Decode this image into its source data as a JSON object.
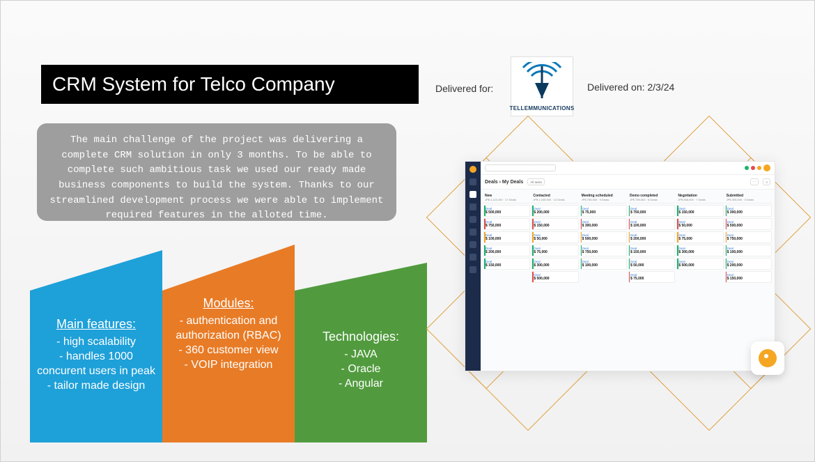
{
  "title": "CRM System for Telco Company",
  "description": "The main challenge of the project was delivering a complete CRM solution in only 3 months. To be able to complete such ambitious task we used our ready made business components to build the system. Thanks to our streamlined development process we were able to implement required features in the alloted time.",
  "delivered_for_label": "Delivered for:",
  "delivered_on_label": "Delivered on: 2/3/24",
  "logo_text": "TELLEMMUNICATIONS",
  "cards": {
    "features": {
      "heading": "Main features:",
      "l1": "- high scalability",
      "l2": "- handles 1000 concurent users in peak",
      "l3": "- tailor made design"
    },
    "modules": {
      "heading": "Modules:",
      "l1": "- authentication and authorization (RBAC)",
      "l2": "- 360 customer view",
      "l3": "- VOIP integration"
    },
    "tech": {
      "heading": "Technologies:",
      "l1": "- JAVA",
      "l2": "- Oracle",
      "l3": "- Angular"
    }
  },
  "app": {
    "breadcrumb": "Deals › My Deals",
    "columns": [
      {
        "title": "New",
        "sub": "JP$ 4,119,200 · 17 Deals"
      },
      {
        "title": "Contacted",
        "sub": "JP$ 1,045,000 · 12 Deals"
      },
      {
        "title": "Meeting scheduled",
        "sub": "JP$ 765,000 · 9 Deals"
      },
      {
        "title": "Demo completed",
        "sub": "JP$ 758,000 · 6 Deals"
      },
      {
        "title": "Negotiation",
        "sub": "JP$ 558,000 · 7 Deals"
      },
      {
        "title": "Submitted",
        "sub": "JP$ 305,000 · 9 Deals"
      }
    ],
    "sample_amounts": [
      "$ 500,000",
      "$ 750,000",
      "$ 100,000",
      "$ 200,000",
      "$ 150,000",
      "$ 50,000",
      "$ 75,000",
      "$ 300,000"
    ]
  }
}
